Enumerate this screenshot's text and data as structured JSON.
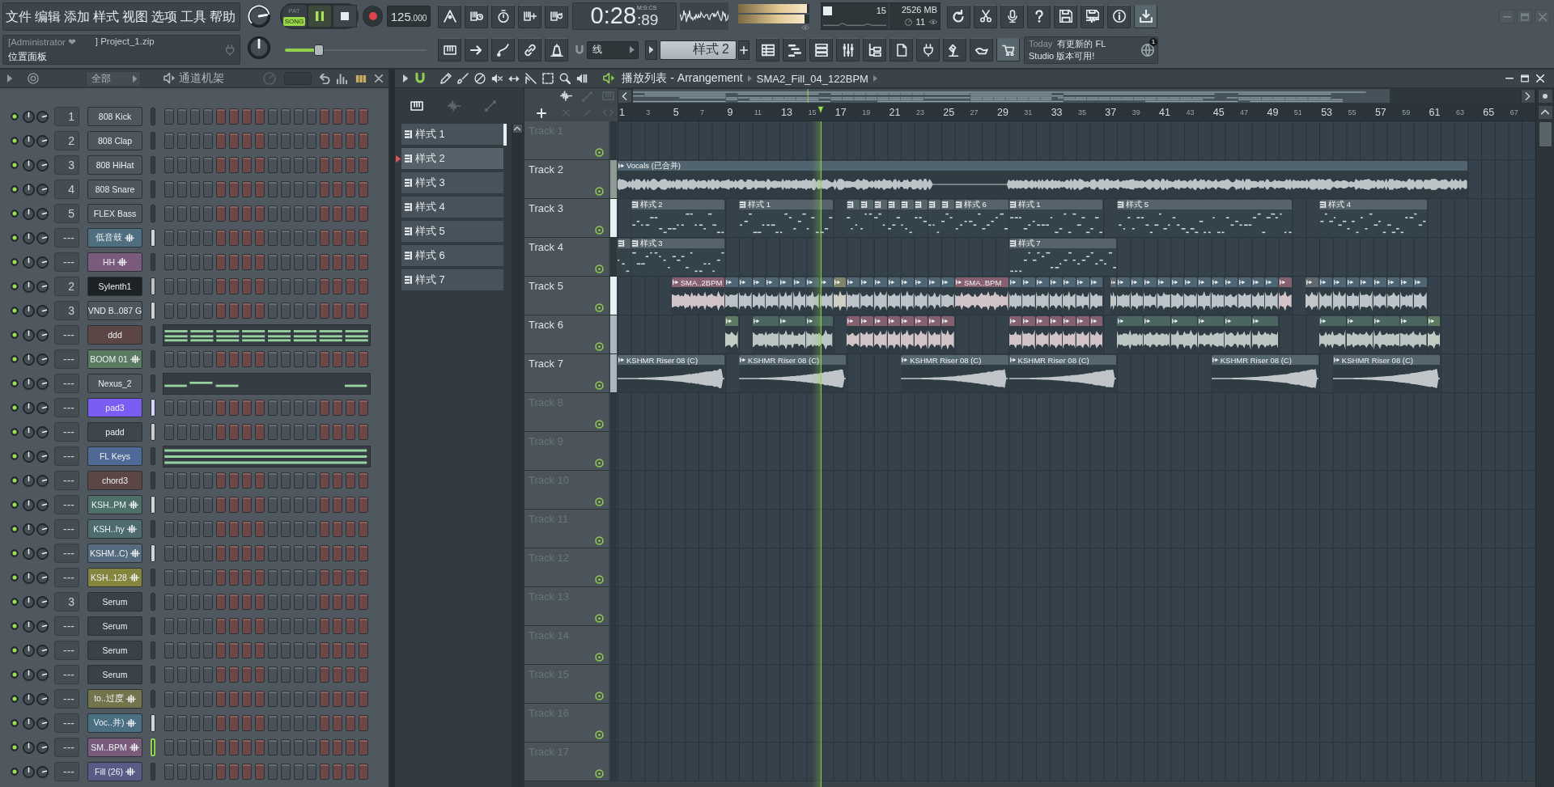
{
  "menu": [
    "文件",
    "编辑",
    "添加",
    "样式",
    "视图",
    "选项",
    "工具",
    "帮助"
  ],
  "hint_bar": {
    "user": "[Administrator ❤",
    "project": "] Project_1.zip",
    "hint": "位置面板"
  },
  "transport": {
    "modes": [
      {
        "label": "PAT",
        "selected": false
      },
      {
        "label": "SONG",
        "selected": true
      }
    ],
    "playing": true,
    "tempo": {
      "whole": "125",
      "fraction": ".000"
    },
    "song_position": {
      "level": 0.24
    }
  },
  "time": {
    "main": "0:28",
    "fraction": ":89",
    "unit": "M:S:CS"
  },
  "output_meter": [
    {
      "level": 0.97
    },
    {
      "level": 0.93
    }
  ],
  "resources": {
    "cpu": "15",
    "memory": "2526 MB",
    "polyphony": "11"
  },
  "snap": "线",
  "pattern_selector": "样式 2",
  "news": {
    "date": "Today",
    "lines": [
      "有更新的 FL",
      "Studio 版本可用!"
    ],
    "badge": "1"
  },
  "channel_rack": {
    "filter": "全部",
    "title": "通道机架",
    "channels": [
      {
        "name": "808 Kick",
        "track": "1",
        "kind": "steps",
        "audio": false,
        "color": "#4c565c",
        "selected": false,
        "focused": false
      },
      {
        "name": "808 Clap",
        "track": "2",
        "kind": "steps",
        "audio": false,
        "color": "#4c565c",
        "selected": false,
        "focused": false
      },
      {
        "name": "808 HiHat",
        "track": "3",
        "kind": "steps",
        "audio": false,
        "color": "#4c565c",
        "selected": false,
        "focused": false
      },
      {
        "name": "808 Snare",
        "track": "4",
        "kind": "steps",
        "audio": false,
        "color": "#4c565c",
        "selected": false,
        "focused": false
      },
      {
        "name": "FLEX Bass",
        "track": "5",
        "kind": "steps",
        "audio": false,
        "color": "#4c565c",
        "selected": false,
        "focused": false
      },
      {
        "name": "低音鼓",
        "track": "---",
        "kind": "steps",
        "audio": true,
        "color": "#4f6f80",
        "selected": true,
        "focused": false
      },
      {
        "name": "HH",
        "track": "---",
        "kind": "steps",
        "audio": true,
        "color": "#7a5b7b",
        "selected": false,
        "focused": false
      },
      {
        "name": "Sylenth1",
        "track": "2",
        "kind": "steps",
        "audio": false,
        "color": "#1d2225",
        "selected": true,
        "focused": false
      },
      {
        "name": "VND B..087 G",
        "track": "3",
        "kind": "steps",
        "audio": false,
        "color": "#4c565c",
        "selected": true,
        "focused": false
      },
      {
        "name": "ddd",
        "track": "---",
        "kind": "notes",
        "audio": false,
        "color": "#5c4545",
        "selected": false,
        "focused": false
      },
      {
        "name": "BOOM 01",
        "track": "---",
        "kind": "steps",
        "audio": true,
        "color": "#5a7a62",
        "selected": false,
        "focused": false
      },
      {
        "name": "Nexus_2",
        "track": "---",
        "kind": "notes",
        "audio": false,
        "color": "#4c565c",
        "selected": false,
        "focused": false
      },
      {
        "name": "pad3",
        "track": "---",
        "kind": "steps",
        "audio": false,
        "color": "#7b5cf5",
        "selected": true,
        "focused": false
      },
      {
        "name": "padd",
        "track": "---",
        "kind": "steps",
        "audio": false,
        "color": "#3e464b",
        "selected": true,
        "focused": false
      },
      {
        "name": "FL Keys",
        "track": "---",
        "kind": "notes",
        "audio": false,
        "color": "#506a98",
        "selected": false,
        "focused": false
      },
      {
        "name": "chord3",
        "track": "---",
        "kind": "steps",
        "audio": false,
        "color": "#5c4545",
        "selected": false,
        "focused": false
      },
      {
        "name": "KSH..PM",
        "track": "---",
        "kind": "steps",
        "audio": true,
        "color": "#4e7068",
        "selected": true,
        "focused": false
      },
      {
        "name": "KSH..hy",
        "track": "---",
        "kind": "steps",
        "audio": true,
        "color": "#4e6c70",
        "selected": false,
        "focused": false
      },
      {
        "name": "KSHM..C)",
        "track": "---",
        "kind": "steps",
        "audio": true,
        "color": "#566a7e",
        "selected": true,
        "focused": false
      },
      {
        "name": "KSH..128",
        "track": "---",
        "kind": "steps",
        "audio": true,
        "color": "#86853e",
        "selected": false,
        "focused": false
      },
      {
        "name": "Serum",
        "track": "3",
        "kind": "steps",
        "audio": false,
        "color": "#3a4247",
        "selected": false,
        "focused": false
      },
      {
        "name": "Serum",
        "track": "---",
        "kind": "steps",
        "audio": false,
        "color": "#3a4247",
        "selected": false,
        "focused": false
      },
      {
        "name": "Serum",
        "track": "---",
        "kind": "steps",
        "audio": false,
        "color": "#3a4247",
        "selected": false,
        "focused": false
      },
      {
        "name": "Serum",
        "track": "---",
        "kind": "steps",
        "audio": false,
        "color": "#3a4247",
        "selected": false,
        "focused": false
      },
      {
        "name": "to..过度",
        "track": "---",
        "kind": "steps",
        "audio": true,
        "color": "#73744c",
        "selected": false,
        "focused": false
      },
      {
        "name": "Voc..并)",
        "track": "---",
        "kind": "steps",
        "audio": true,
        "color": "#4a6e82",
        "selected": true,
        "focused": false
      },
      {
        "name": "SM..BPM",
        "track": "---",
        "kind": "steps",
        "audio": true,
        "color": "#7a5b7b",
        "selected": false,
        "focused": true
      },
      {
        "name": "Fill (26)",
        "track": "---",
        "kind": "steps",
        "audio": true,
        "color": "#5a5a86",
        "selected": false,
        "focused": false
      }
    ]
  },
  "playlist": {
    "title": "播放列表 - Arrangement",
    "source": "SMA2_Fill_04_122BPM",
    "patterns": [
      {
        "label": "样式 1",
        "selected": false
      },
      {
        "label": "样式 2",
        "selected": true
      },
      {
        "label": "样式 3",
        "selected": false
      },
      {
        "label": "样式 4",
        "selected": false
      },
      {
        "label": "样式 5",
        "selected": false
      },
      {
        "label": "样式 6",
        "selected": false
      },
      {
        "label": "样式 7",
        "selected": false
      }
    ],
    "ruler": [
      "1",
      "3",
      "5",
      "7",
      "9",
      "11",
      "13",
      "15",
      "17",
      "19",
      "21",
      "23",
      "25",
      "27",
      "29",
      "31",
      "33",
      "35",
      "37",
      "39",
      "41",
      "43",
      "45",
      "47",
      "49",
      "51",
      "53",
      "55",
      "57",
      "59",
      "61",
      "63",
      "65",
      "67"
    ],
    "playhead": {
      "level": 0.221
    },
    "tracks": [
      {
        "label": "Track 1",
        "empty": true,
        "color": "#2d373e"
      },
      {
        "label": "Track 2",
        "empty": false,
        "color": "#8e9a93",
        "clips": [
          {
            "kind": "audio",
            "label": "Vocals (已合并)",
            "color": "#50636e"
          }
        ]
      },
      {
        "label": "Track 3",
        "empty": false,
        "color": "#e6f2f2",
        "clips": [
          {
            "kind": "pattern",
            "label": "样式 2"
          },
          {
            "kind": "pattern",
            "label": "样式 1"
          },
          {
            "kind": "pattern"
          },
          {
            "kind": "pattern"
          },
          {
            "kind": "pattern"
          },
          {
            "kind": "pattern"
          },
          {
            "kind": "pattern"
          },
          {
            "kind": "pattern"
          },
          {
            "kind": "pattern"
          },
          {
            "kind": "pattern"
          },
          {
            "kind": "pattern",
            "label": "样式 6"
          },
          {
            "kind": "pattern",
            "label": "样式 1"
          },
          {
            "kind": "pattern",
            "label": "样式 5"
          },
          {
            "kind": "pattern",
            "label": "样式 4"
          }
        ]
      },
      {
        "label": "Track 4",
        "empty": false,
        "color": "#2d373e",
        "clips": [
          {
            "kind": "pattern"
          },
          {
            "kind": "pattern",
            "label": "样式 3"
          },
          {
            "kind": "pattern",
            "label": "样式 7"
          }
        ]
      },
      {
        "label": "Track 5",
        "empty": false,
        "color": "#e6f2f2",
        "clips": [
          {
            "kind": "audio",
            "label": "SMA..2BPM",
            "color": "#86606f"
          },
          {
            "kind": "audio",
            "color": "#4e6573"
          },
          {
            "kind": "audio",
            "color": "#4e6573"
          },
          {
            "kind": "audio",
            "color": "#4e6573"
          },
          {
            "kind": "audio",
            "color": "#4e6573"
          },
          {
            "kind": "audio",
            "color": "#4e6573"
          },
          {
            "kind": "audio",
            "color": "#4e6573"
          },
          {
            "kind": "audio",
            "color": "#4e6573"
          },
          {
            "kind": "audio",
            "color": "#4e6573"
          },
          {
            "kind": "audio",
            "color": "#7e846a"
          },
          {
            "kind": "audio",
            "color": "#4e6573"
          },
          {
            "kind": "audio",
            "color": "#4e6573"
          },
          {
            "kind": "audio",
            "color": "#4e6573"
          },
          {
            "kind": "audio",
            "color": "#4e6573"
          },
          {
            "kind": "audio",
            "color": "#4e6573"
          },
          {
            "kind": "audio",
            "color": "#4e6573"
          },
          {
            "kind": "audio",
            "color": "#4e6573"
          },
          {
            "kind": "audio",
            "color": "#4e6573"
          },
          {
            "kind": "audio",
            "label": "SMA..BPM",
            "color": "#86606f"
          },
          {
            "kind": "audio",
            "color": "#4e6573"
          },
          {
            "kind": "audio",
            "color": "#4e6573"
          },
          {
            "kind": "audio",
            "color": "#4e6573"
          },
          {
            "kind": "audio",
            "color": "#4e6573"
          },
          {
            "kind": "audio",
            "color": "#4e6573"
          },
          {
            "kind": "audio",
            "color": "#4e6573"
          },
          {
            "kind": "audio",
            "color": "#4e6573"
          },
          {
            "kind": "audio",
            "color": "#62686b"
          },
          {
            "kind": "audio",
            "color": "#4e6573"
          },
          {
            "kind": "audio",
            "color": "#4e6573"
          },
          {
            "kind": "audio",
            "color": "#4e6573"
          },
          {
            "kind": "audio",
            "color": "#4e6573"
          },
          {
            "kind": "audio",
            "color": "#4e6573"
          },
          {
            "kind": "audio",
            "color": "#4e6573"
          },
          {
            "kind": "audio",
            "color": "#4e6573"
          },
          {
            "kind": "audio",
            "color": "#4e6573"
          },
          {
            "kind": "audio",
            "color": "#4e6573"
          },
          {
            "kind": "audio",
            "color": "#4e6573"
          },
          {
            "kind": "audio",
            "color": "#4e6573"
          },
          {
            "kind": "audio",
            "color": "#4e6573"
          },
          {
            "kind": "audio",
            "color": "#86606f"
          },
          {
            "kind": "audio",
            "color": "#62686b"
          },
          {
            "kind": "audio",
            "color": "#4e6573"
          },
          {
            "kind": "audio",
            "color": "#4e6573"
          },
          {
            "kind": "audio",
            "color": "#4e6573"
          },
          {
            "kind": "audio",
            "color": "#4e6573"
          },
          {
            "kind": "audio",
            "color": "#4e6573"
          },
          {
            "kind": "audio",
            "color": "#4e6573"
          },
          {
            "kind": "audio",
            "color": "#4e6573"
          },
          {
            "kind": "audio",
            "color": "#4e6573"
          }
        ]
      },
      {
        "label": "Track 6",
        "empty": false,
        "color": "#a9b6bd",
        "clips": [
          {
            "kind": "audio",
            "color": "#5c7a62"
          },
          {
            "kind": "audio",
            "color": "#4b6660"
          },
          {
            "kind": "audio",
            "color": "#4b6660"
          },
          {
            "kind": "audio",
            "color": "#4b6660"
          },
          {
            "kind": "audio",
            "color": "#86606f"
          },
          {
            "kind": "audio",
            "color": "#86606f"
          },
          {
            "kind": "audio",
            "color": "#86606f"
          },
          {
            "kind": "audio",
            "color": "#86606f"
          },
          {
            "kind": "audio",
            "color": "#86606f"
          },
          {
            "kind": "audio",
            "color": "#86606f"
          },
          {
            "kind": "audio",
            "color": "#86606f"
          },
          {
            "kind": "audio",
            "color": "#86606f"
          },
          {
            "kind": "audio",
            "color": "#86606f"
          },
          {
            "kind": "audio",
            "color": "#86606f"
          },
          {
            "kind": "audio",
            "color": "#86606f"
          },
          {
            "kind": "audio",
            "color": "#86606f"
          },
          {
            "kind": "audio",
            "color": "#86606f"
          },
          {
            "kind": "audio",
            "color": "#86606f"
          },
          {
            "kind": "audio",
            "color": "#86606f"
          },
          {
            "kind": "audio",
            "color": "#4b6660"
          },
          {
            "kind": "audio",
            "color": "#4b6660"
          },
          {
            "kind": "audio",
            "color": "#4b6660"
          },
          {
            "kind": "audio",
            "color": "#4b6660"
          },
          {
            "kind": "audio",
            "color": "#4b6660"
          },
          {
            "kind": "audio",
            "color": "#4b6660"
          },
          {
            "kind": "audio",
            "color": "#4b6660"
          },
          {
            "kind": "audio",
            "color": "#4b6660"
          },
          {
            "kind": "audio",
            "color": "#4b6660"
          },
          {
            "kind": "audio",
            "color": "#4b6660"
          },
          {
            "kind": "audio",
            "color": "#5c7a62"
          }
        ]
      },
      {
        "label": "Track 7",
        "empty": false,
        "color": "#a9b6bd",
        "clips": [
          {
            "kind": "audio",
            "label": "KSHMR Riser 08 (C)",
            "color": "#56666e"
          },
          {
            "kind": "audio",
            "label": "KSHMR Riser 08 (C)",
            "color": "#56666e"
          },
          {
            "kind": "audio",
            "label": "KSHMR Riser 08 (C)",
            "color": "#56666e"
          },
          {
            "kind": "audio",
            "label": "KSHMR Riser 08 (C)",
            "color": "#56666e"
          },
          {
            "kind": "audio",
            "label": "KSHMR Riser 08 (C)",
            "color": "#56666e"
          },
          {
            "kind": "audio",
            "label": "KSHMR Riser 08 (C)",
            "color": "#56666e"
          }
        ]
      },
      {
        "label": "Track 8",
        "empty": true,
        "color": "#2d373e"
      },
      {
        "label": "Track 9",
        "empty": true,
        "color": "#2d373e"
      },
      {
        "label": "Track 10",
        "empty": true,
        "color": "#2d373e"
      },
      {
        "label": "Track 11",
        "empty": true,
        "color": "#2d373e"
      },
      {
        "label": "Track 12",
        "empty": true,
        "color": "#2d373e"
      },
      {
        "label": "Track 13",
        "empty": true,
        "color": "#2d373e"
      },
      {
        "label": "Track 14",
        "empty": true,
        "color": "#2d373e"
      },
      {
        "label": "Track 15",
        "empty": true,
        "color": "#2d373e"
      },
      {
        "label": "Track 16",
        "empty": true,
        "color": "#2d373e"
      },
      {
        "label": "Track 17",
        "empty": true,
        "color": "#2d373e"
      }
    ]
  }
}
